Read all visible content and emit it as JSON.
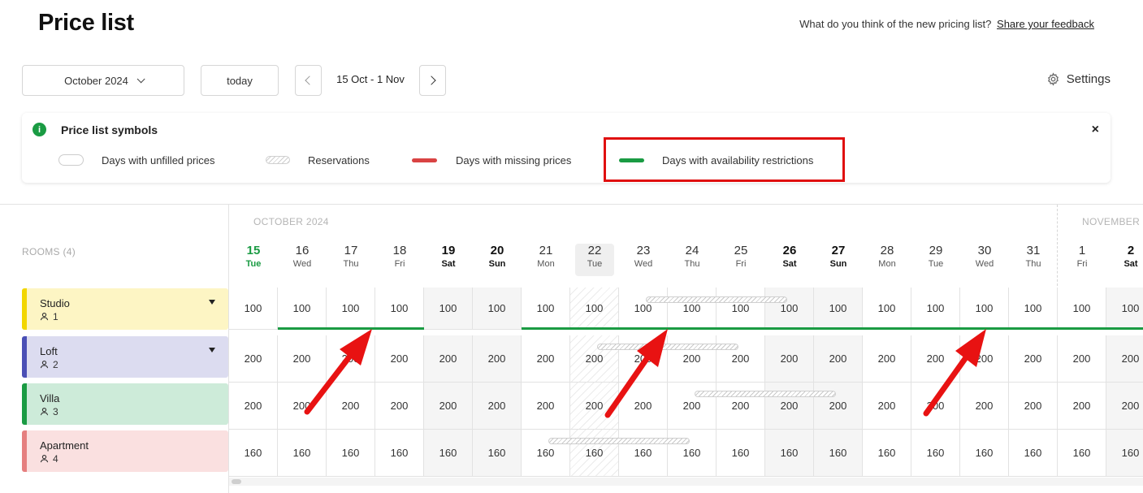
{
  "header": {
    "title": "Price list",
    "feedback_text": "What do you think of the new pricing list?",
    "feedback_link": "Share your feedback"
  },
  "toolbar": {
    "month": "October 2024",
    "today": "today",
    "range": "15 Oct - 1 Nov",
    "settings": "Settings"
  },
  "legend": {
    "title": "Price list symbols",
    "close": "×",
    "items": {
      "unfilled": "Days with unfilled prices",
      "reservations": "Reservations",
      "missing": "Days with missing prices",
      "availability": "Days with availability restrictions"
    },
    "colors": {
      "missing": "#d94343",
      "availability": "#1a9b43",
      "info": "#1a9b43"
    }
  },
  "calendar": {
    "rooms_label": "ROOMS (4)",
    "months": [
      "OCTOBER 2024",
      "NOVEMBER"
    ],
    "days": [
      {
        "num": "15",
        "wd": "Tue"
      },
      {
        "num": "16",
        "wd": "Wed"
      },
      {
        "num": "17",
        "wd": "Thu"
      },
      {
        "num": "18",
        "wd": "Fri"
      },
      {
        "num": "19",
        "wd": "Sat"
      },
      {
        "num": "20",
        "wd": "Sun"
      },
      {
        "num": "21",
        "wd": "Mon"
      },
      {
        "num": "22",
        "wd": "Tue"
      },
      {
        "num": "23",
        "wd": "Wed"
      },
      {
        "num": "24",
        "wd": "Thu"
      },
      {
        "num": "25",
        "wd": "Fri"
      },
      {
        "num": "26",
        "wd": "Sat"
      },
      {
        "num": "27",
        "wd": "Sun"
      },
      {
        "num": "28",
        "wd": "Mon"
      },
      {
        "num": "29",
        "wd": "Tue"
      },
      {
        "num": "30",
        "wd": "Wed"
      },
      {
        "num": "31",
        "wd": "Thu"
      },
      {
        "num": "1",
        "wd": "Fri"
      },
      {
        "num": "2",
        "wd": "Sat"
      }
    ],
    "rooms": [
      {
        "name": "Studio",
        "capacity": "1",
        "color": "#fdf5c4",
        "bar": "#f2d600",
        "prices": [
          "100",
          "100",
          "100",
          "100",
          "100",
          "100",
          "100",
          "100",
          "100",
          "100",
          "100",
          "100",
          "100",
          "100",
          "100",
          "100",
          "100",
          "100",
          "100"
        ]
      },
      {
        "name": "Loft",
        "capacity": "2",
        "color": "#dcdcf0",
        "bar": "#4a4fb5",
        "prices": [
          "200",
          "200",
          "200",
          "200",
          "200",
          "200",
          "200",
          "200",
          "200",
          "200",
          "200",
          "200",
          "200",
          "200",
          "200",
          "200",
          "200",
          "200",
          "200"
        ]
      },
      {
        "name": "Villa",
        "capacity": "3",
        "color": "#cdebd9",
        "bar": "#1a9b43",
        "prices": [
          "200",
          "200",
          "200",
          "200",
          "200",
          "200",
          "200",
          "200",
          "200",
          "200",
          "200",
          "200",
          "200",
          "200",
          "200",
          "200",
          "200",
          "200",
          "200"
        ]
      },
      {
        "name": "Apartment",
        "capacity": "4",
        "color": "#fae0e0",
        "bar": "#e57f7f",
        "prices": [
          "160",
          "160",
          "160",
          "160",
          "160",
          "160",
          "160",
          "160",
          "160",
          "160",
          "160",
          "160",
          "160",
          "160",
          "160",
          "160",
          "160",
          "160",
          "160"
        ]
      }
    ]
  }
}
